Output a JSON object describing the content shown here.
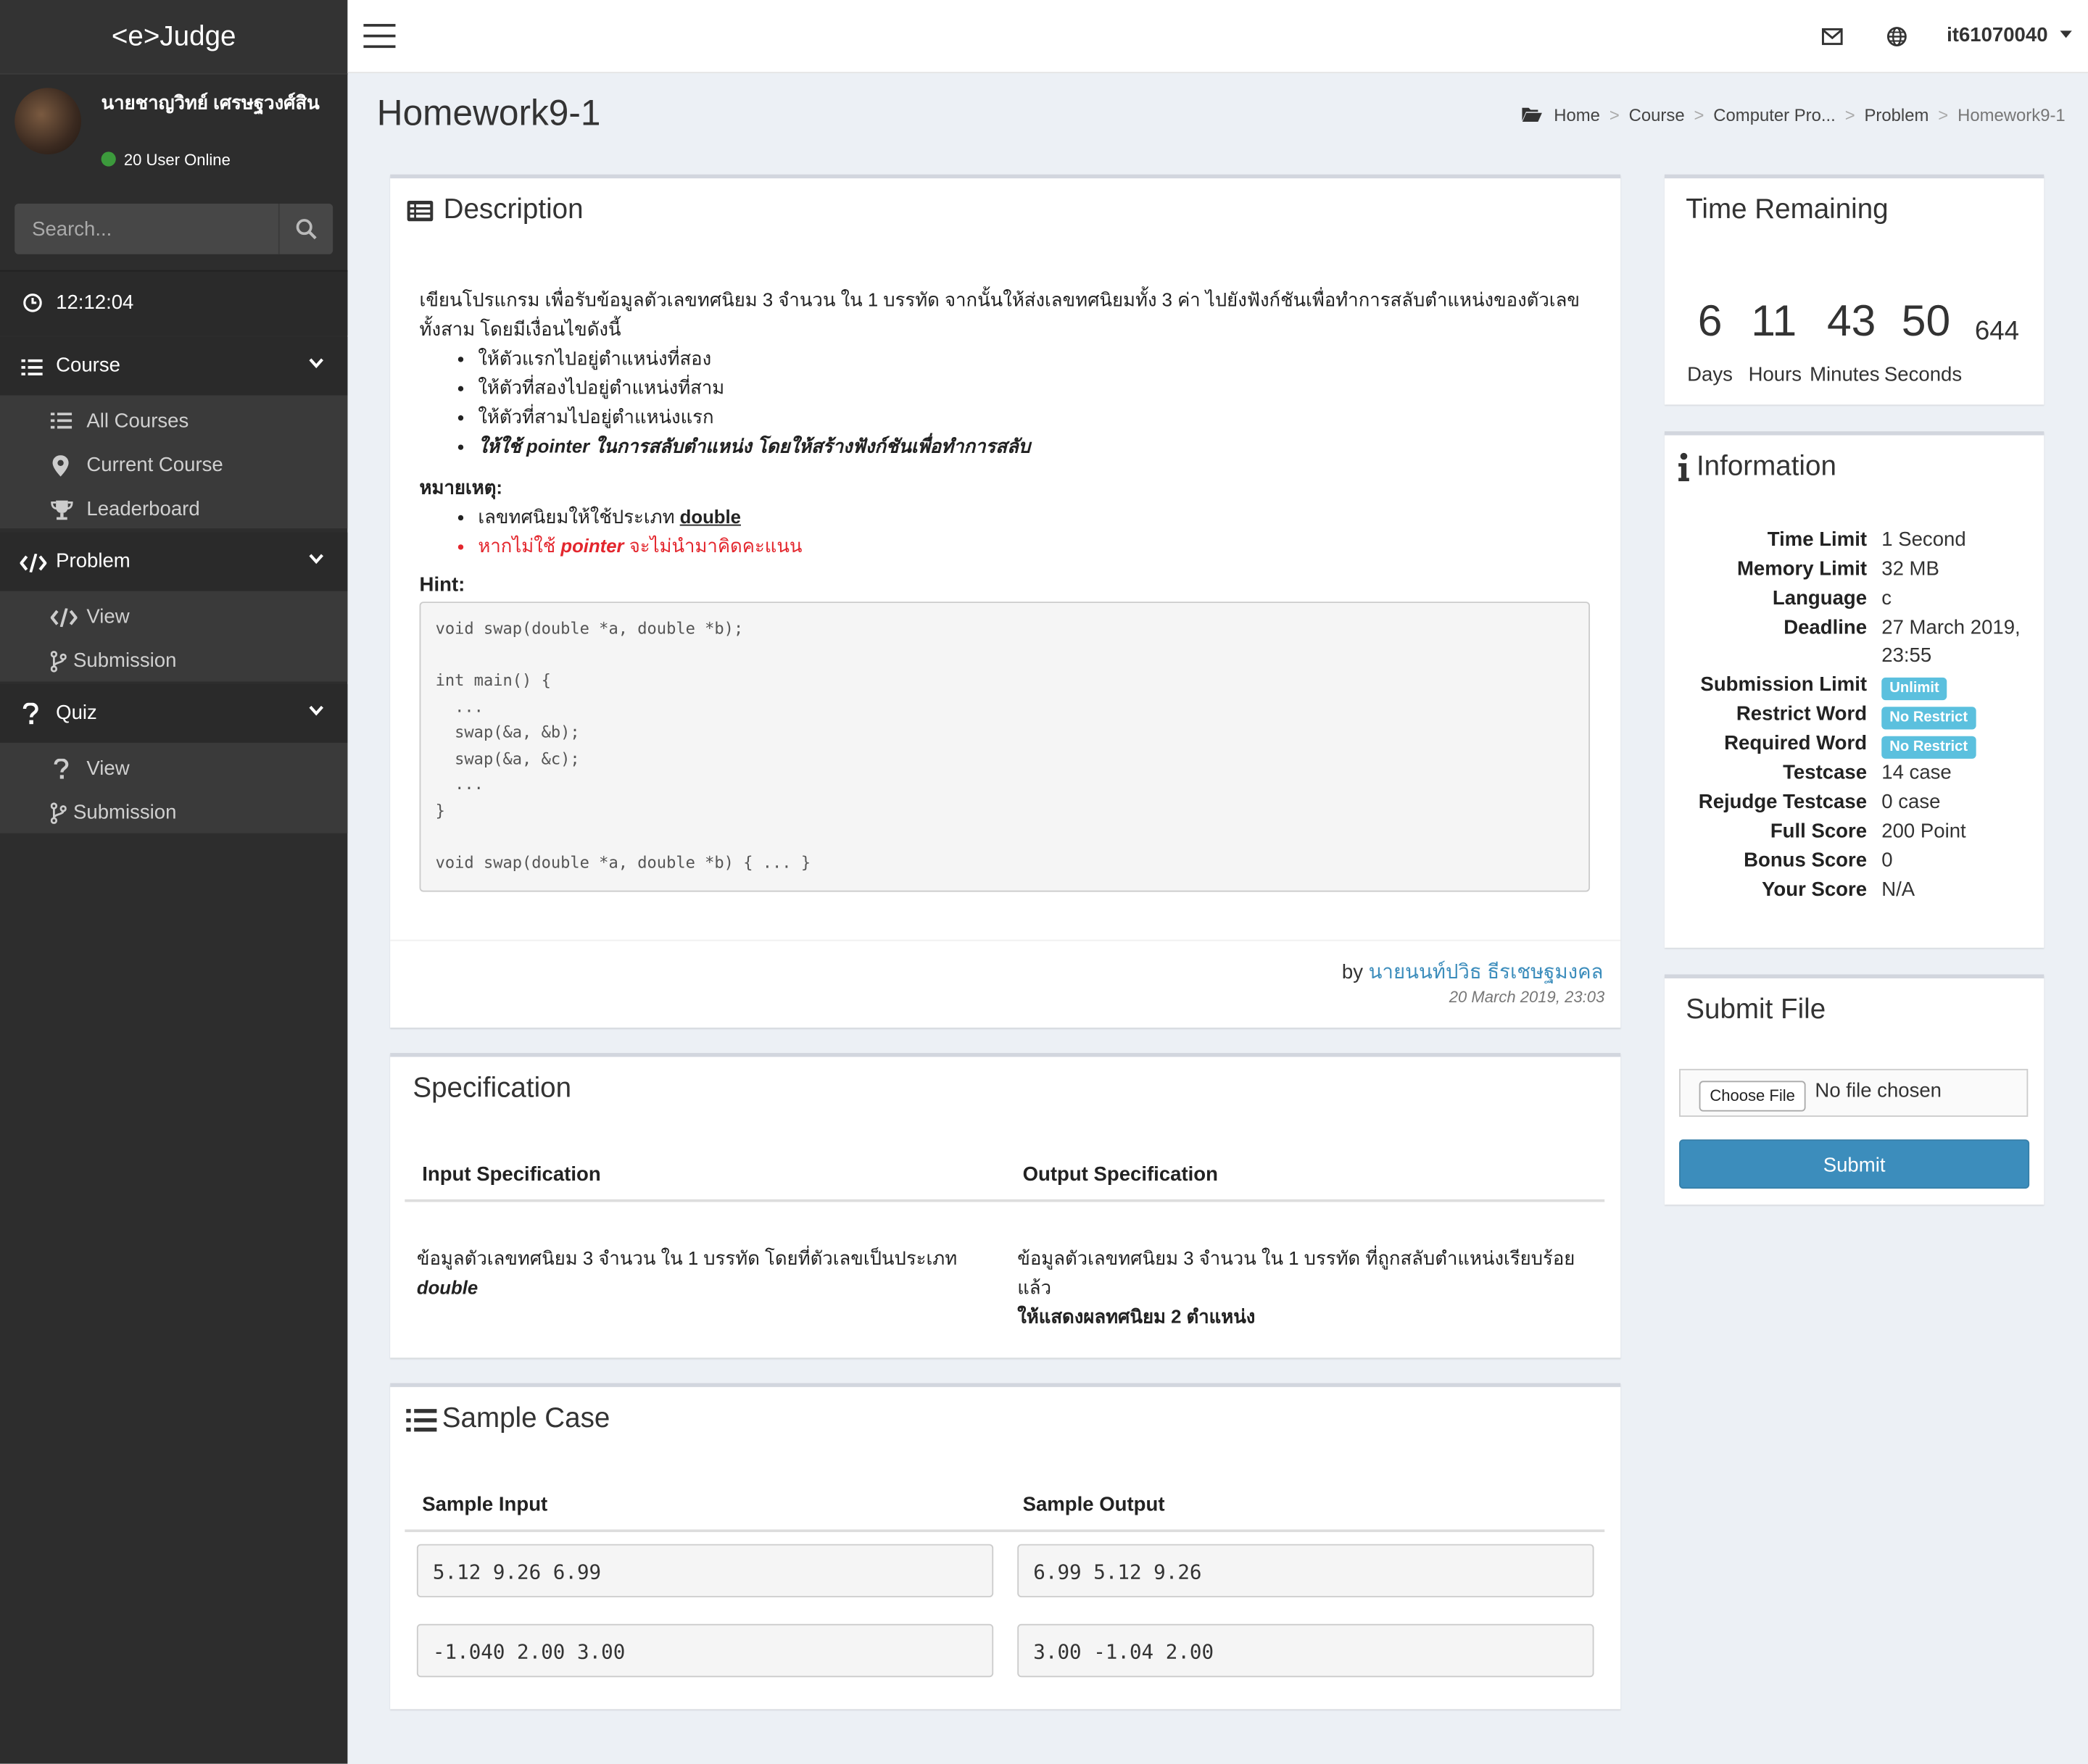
{
  "brand": "<e>Judge",
  "user": {
    "name": "นายชาญวิทย์ เศรษฐวงศ์สิน",
    "online": "20 User Online"
  },
  "search": {
    "placeholder": "Search..."
  },
  "clock": "12:12:04",
  "menu": {
    "course": {
      "label": "Course",
      "items": [
        "All Courses",
        "Current Course",
        "Leaderboard"
      ]
    },
    "problem": {
      "label": "Problem",
      "items": [
        "View",
        "Submission"
      ]
    },
    "quiz": {
      "label": "Quiz",
      "items": [
        "View",
        "Submission"
      ]
    }
  },
  "topbar": {
    "username": "it61070040"
  },
  "page": {
    "title": "Homework9-1"
  },
  "breadcrumb": [
    "Home",
    "Course",
    "Computer Pro...",
    "Problem",
    "Homework9-1"
  ],
  "description": {
    "title": "Description",
    "intro": "เขียนโปรแกรม เพื่อรับข้อมูลตัวเลขทศนิยม 3 จำนวน ใน 1 บรรทัด จากนั้นให้ส่งเลขทศนิยมทั้ง 3 ค่า ไปยังฟังก์ชันเพื่อทำการสลับตำแหน่งของตัวเลขทั้งสาม โดยมีเงื่อนไขดังนี้",
    "rules": [
      "ให้ตัวแรกไปอยู่ตำแหน่งที่สอง",
      "ให้ตัวที่สองไปอยู่ตำแหน่งที่สาม",
      "ให้ตัวที่สามไปอยู่ตำแหน่งแรก"
    ],
    "rule_bold": "ให้ใช้ pointer ในการสลับตำแหน่ง โดยให้สร้างฟังก์ชันเพื่อทำการสลับ",
    "note_label": "หมายเหตุ:",
    "note1_prefix": "เลขทศนิยมให้ใช้ประเภท ",
    "note1_type": "double",
    "note2_a": "หากไม่ใช้ ",
    "note2_b": "pointer",
    "note2_c": " จะไม่นำมาคิดคะแนน",
    "hint_label": "Hint:",
    "hint_code": "void swap(double *a, double *b);\n\nint main() {\n  ...\n  swap(&a, &b);\n  swap(&a, &c);\n  ...\n}\n\nvoid swap(double *a, double *b) { ... }",
    "by_prefix": "by ",
    "author": "นายนนท์ปวิธ ธีรเชษฐมงคล",
    "date": "20 March 2019, 23:03"
  },
  "specification": {
    "title": "Specification",
    "input_header": "Input Specification",
    "output_header": "Output Specification",
    "input_text": "ข้อมูลตัวเลขทศนิยม 3 จำนวน ใน 1 บรรทัด โดยที่ตัวเลขเป็นประเภท",
    "input_type": "double",
    "output_text": "ข้อมูลตัวเลขทศนิยม 3 จำนวน ใน 1 บรรทัด ที่ถูกสลับตำแหน่งเรียบร้อยแล้ว",
    "output_note": "ให้แสดงผลทศนิยม 2 ตำแหน่ง"
  },
  "samples": {
    "title": "Sample Case",
    "input_header": "Sample Input",
    "output_header": "Sample Output",
    "rows": [
      {
        "input": "5.12 9.26 6.99",
        "output": "6.99 5.12 9.26"
      },
      {
        "input": "-1.040 2.00 3.00",
        "output": "3.00 -1.04 2.00"
      }
    ]
  },
  "timer": {
    "title": "Time Remaining",
    "days": "6",
    "hours": "11",
    "minutes": "43",
    "seconds": "50",
    "ms": "644",
    "labels": [
      "Days",
      "Hours",
      "Minutes",
      "Seconds"
    ]
  },
  "info": {
    "title": "Information",
    "rows": [
      {
        "k": "Time Limit",
        "v": "1 Second"
      },
      {
        "k": "Memory Limit",
        "v": "32 MB"
      },
      {
        "k": "Language",
        "v": "c"
      },
      {
        "k": "Deadline",
        "v": "27 March 2019,"
      },
      {
        "k": "",
        "v": "23:55"
      },
      {
        "k": "Submission Limit",
        "v": "Unlimit"
      },
      {
        "k": "Restrict Word",
        "v": "No Restrict"
      },
      {
        "k": "Required Word",
        "v": "No Restrict"
      },
      {
        "k": "Testcase",
        "v": "14 case"
      },
      {
        "k": "Rejudge Testcase",
        "v": "0 case"
      },
      {
        "k": "Full Score",
        "v": "200 Point"
      },
      {
        "k": "Bonus Score",
        "v": "0"
      },
      {
        "k": "Your Score",
        "v": "N/A"
      }
    ],
    "badge_color": "#5bc0de"
  },
  "submit": {
    "title": "Submit File",
    "choose_label": "Choose File",
    "no_file": "No file chosen",
    "button": "Submit"
  },
  "colors": {
    "sidebar": "#2d2d2d",
    "accent": "#3c8dbc",
    "danger": "#e3262d",
    "badge": "#5bc0de"
  }
}
